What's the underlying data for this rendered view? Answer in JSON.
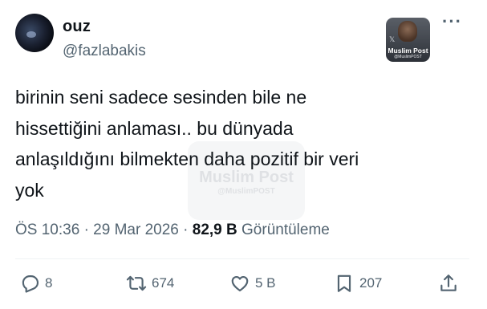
{
  "author": {
    "display_name": "ouz",
    "handle": "@fazlabakis"
  },
  "badge": {
    "title": "Muslim Post",
    "handle": "@MuslimPOST"
  },
  "watermark": {
    "title": "Muslim Post",
    "handle": "@MuslimPOST"
  },
  "tweet": {
    "text": "birinin seni sadece sesinden bile ne\nhissettiğini anlaması.. bu dünyada\nanlaşıldığını bilmekten daha pozitif bir veri\nyok",
    "time": "ÖS 10:36",
    "separator": "·",
    "date": "29 Mar 2026",
    "views_count": "82,9 B",
    "views_label": "Görüntüleme"
  },
  "actions": {
    "replies": "8",
    "reposts": "674",
    "likes": "5 B",
    "bookmarks": "207"
  },
  "icons": [
    "more-icon",
    "reply-icon",
    "repost-icon",
    "like-icon",
    "bookmark-icon",
    "share-icon"
  ],
  "colors": {
    "text": "#0f1419",
    "secondary": "#536471",
    "divider": "#eff3f4"
  }
}
